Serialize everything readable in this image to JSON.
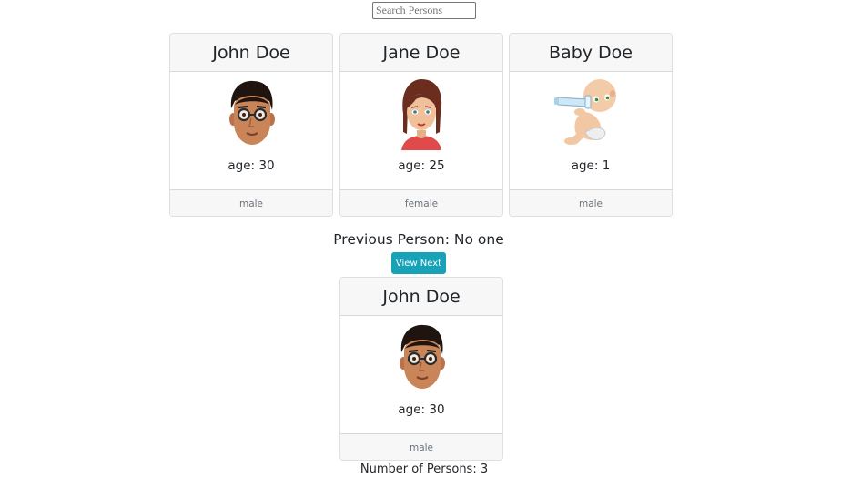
{
  "search": {
    "placeholder": "Search Persons",
    "value": ""
  },
  "persons": [
    {
      "name": "John Doe",
      "age_text": "age: 30",
      "gender": "male",
      "avatar": "man-with-glasses-avatar"
    },
    {
      "name": "Jane Doe",
      "age_text": "age: 25",
      "gender": "female",
      "avatar": "woman-avatar"
    },
    {
      "name": "Baby Doe",
      "age_text": "age: 1",
      "gender": "male",
      "avatar": "baby-with-bottle-avatar"
    }
  ],
  "previous": {
    "text": "Previous Person: No one"
  },
  "view_next": {
    "label": "View Next",
    "color": "#17a2b8"
  },
  "current": {
    "name": "John Doe",
    "age_text": "age: 30",
    "gender": "male",
    "avatar": "man-with-glasses-avatar"
  },
  "count": {
    "text": "Number of Persons: 3"
  }
}
